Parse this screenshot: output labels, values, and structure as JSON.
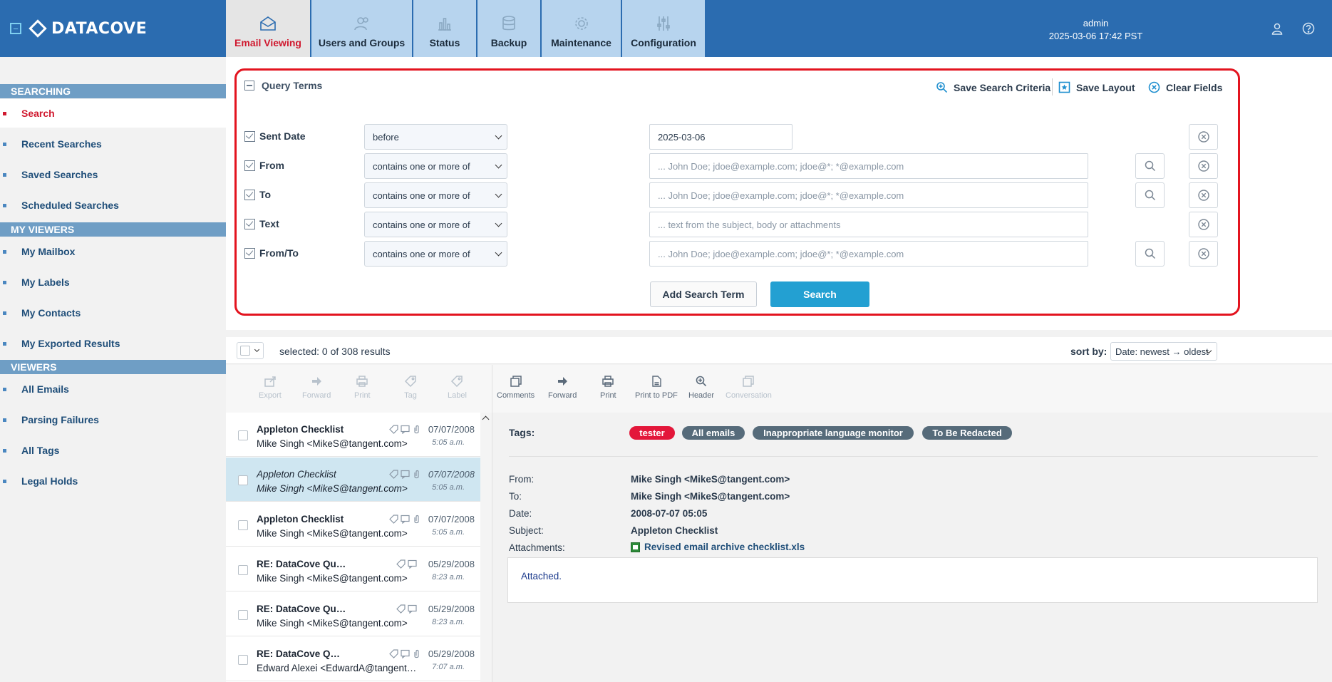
{
  "app": {
    "brand": "DATACOVE",
    "collapse_glyph": "−",
    "user": "admin",
    "datetime": "2025-03-06 17:42 PST"
  },
  "nav": [
    {
      "label": "Email Viewing",
      "icon": "envelope-icon",
      "active": true
    },
    {
      "label": "Users and Groups",
      "icon": "users-icon"
    },
    {
      "label": "Status",
      "icon": "bar-chart-icon"
    },
    {
      "label": "Backup",
      "icon": "database-icon"
    },
    {
      "label": "Maintenance",
      "icon": "gear-icon"
    },
    {
      "label": "Configuration",
      "icon": "sliders-icon"
    }
  ],
  "sidebar": {
    "sections": [
      {
        "heading": "SEARCHING",
        "items": [
          "Search",
          "Recent Searches",
          "Saved Searches",
          "Scheduled Searches"
        ]
      },
      {
        "heading": "MY VIEWERS",
        "items": [
          "My Mailbox",
          "My Labels",
          "My Contacts",
          "My Exported Results"
        ]
      },
      {
        "heading": "VIEWERS",
        "items": [
          "All Emails",
          "Parsing Failures",
          "All Tags",
          "Legal Holds"
        ]
      }
    ],
    "active_item": "Search"
  },
  "query": {
    "title": "Query Terms",
    "actions": {
      "save_criteria": "Save Search Criteria",
      "save_layout": "Save Layout",
      "clear_fields": "Clear Fields"
    },
    "rows": [
      {
        "label": "Sent Date",
        "operator": "before",
        "value": "2025-03-06",
        "placeholder": ""
      },
      {
        "label": "From",
        "operator": "contains one or more of",
        "value": "",
        "placeholder": "... John Doe; jdoe@example.com; jdoe@*; *@example.com"
      },
      {
        "label": "To",
        "operator": "contains one or more of",
        "value": "",
        "placeholder": "... John Doe; jdoe@example.com; jdoe@*; *@example.com"
      },
      {
        "label": "Text",
        "operator": "contains one or more of",
        "value": "",
        "placeholder": "... text from the subject, body or attachments"
      },
      {
        "label": "From/To",
        "operator": "contains one or more of",
        "value": "",
        "placeholder": "... John Doe; jdoe@example.com; jdoe@*; *@example.com"
      }
    ],
    "add_term": "Add Search Term",
    "search": "Search"
  },
  "results": {
    "selected_text": "selected: 0 of 308 results",
    "sort_label": "sort by:",
    "sort_value": "Date: newest → oldest"
  },
  "list_toolbar": [
    "Export",
    "Forward",
    "Print",
    "Tag",
    "Label"
  ],
  "view_toolbar": [
    "Comments",
    "Forward",
    "Print",
    "Print to PDF",
    "Header",
    "Conversation"
  ],
  "emails": [
    {
      "subject": "Appleton Checklist",
      "from": "Mike Singh <MikeS@tangent.com>",
      "date": "07/07/2008",
      "time": "5:05 a.m.",
      "attachment": true,
      "read": false,
      "selected": false
    },
    {
      "subject": "Appleton Checklist",
      "from": "Mike Singh <MikeS@tangent.com>",
      "date": "07/07/2008",
      "time": "5:05 a.m.",
      "attachment": true,
      "read": true,
      "selected": true
    },
    {
      "subject": "Appleton Checklist",
      "from": "Mike Singh <MikeS@tangent.com>",
      "date": "07/07/2008",
      "time": "5:05 a.m.",
      "attachment": true,
      "read": false,
      "selected": false
    },
    {
      "subject": "RE: DataCove Questions",
      "from": "Mike Singh <MikeS@tangent.com>",
      "date": "05/29/2008",
      "time": "8:23 a.m.",
      "attachment": false,
      "read": false,
      "selected": false
    },
    {
      "subject": "RE: DataCove Questions",
      "from": "Mike Singh <MikeS@tangent.com>",
      "date": "05/29/2008",
      "time": "8:23 a.m.",
      "attachment": false,
      "read": false,
      "selected": false
    },
    {
      "subject": "RE: DataCove Questions",
      "from": "Edward Alexei <EdwardA@tangent.com>",
      "date": "05/29/2008",
      "time": "7:07 a.m.",
      "attachment": true,
      "read": false,
      "selected": false
    }
  ],
  "viewer": {
    "tags_label": "Tags:",
    "tags": [
      {
        "name": "tester",
        "color": "#e3173a"
      },
      {
        "name": "All emails",
        "color": "#566b7a"
      },
      {
        "name": "Inappropriate language monitor",
        "color": "#566b7a"
      },
      {
        "name": "To Be Redacted",
        "color": "#566b7a"
      }
    ],
    "from_label": "From:",
    "from": "Mike Singh <MikeS@tangent.com>",
    "to_label": "To:",
    "to": "Mike Singh <MikeS@tangent.com>",
    "date_label": "Date:",
    "date": "2008-07-07 05:05",
    "subject_label": "Subject:",
    "subject": "Appleton Checklist",
    "attachments_label": "Attachments:",
    "attachment": "Revised email archive checklist.xls",
    "body": "Attached."
  },
  "colors": {
    "header": "#2b6cb0",
    "accent": "#d0192f",
    "primary_button": "#23a0d2",
    "highlight_frame": "#e3141f"
  }
}
